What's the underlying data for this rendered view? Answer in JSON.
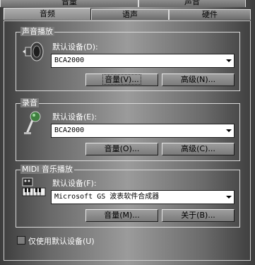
{
  "tabs": {
    "top_row": [
      "音量",
      "声音"
    ],
    "bottom_row": [
      "音频",
      "语声",
      "硬件"
    ],
    "active": "音频"
  },
  "playback": {
    "title": "声音播放",
    "device_label": "默认设备(D):",
    "device_value": "BCA2000",
    "volume_button": "音量(V)...",
    "advanced_button": "高级(N)..."
  },
  "recording": {
    "title": "录音",
    "device_label": "默认设备(E):",
    "device_value": "BCA2000",
    "volume_button": "音量(O)...",
    "advanced_button": "高级(C)..."
  },
  "midi": {
    "title": "MIDI 音乐播放",
    "device_label": "默认设备(F):",
    "device_value": "Microsoft GS 波表软件合成器",
    "volume_button": "音量(M)...",
    "about_button": "关于(B)..."
  },
  "default_only_checkbox": "仅使用默认设备(U)",
  "icons": {
    "playback": "speaker-icon",
    "recording": "microphone-icon",
    "midi": "midi-keyboard-icon"
  },
  "colors": {
    "panel_bg": "#7a7a7a",
    "field_bg": "#ffffff",
    "border_light": "#d9d9d9"
  }
}
